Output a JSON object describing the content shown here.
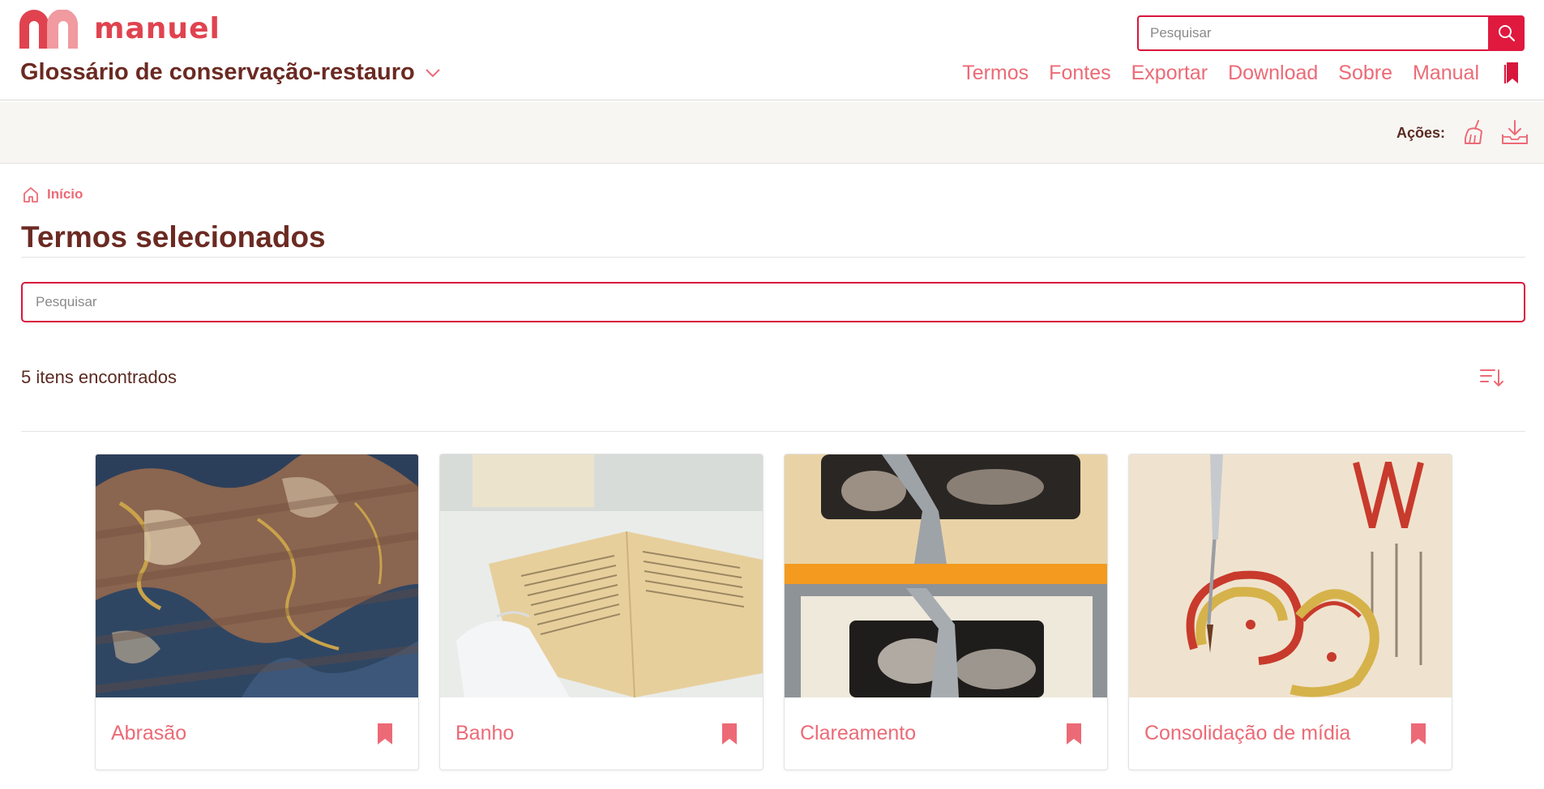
{
  "brand": {
    "logo_text": "manuel",
    "site_title": "Glossário de conservação-restauro"
  },
  "header_search": {
    "placeholder": "Pesquisar"
  },
  "nav": {
    "items": [
      {
        "label": "Termos"
      },
      {
        "label": "Fontes"
      },
      {
        "label": "Exportar"
      },
      {
        "label": "Download"
      },
      {
        "label": "Sobre"
      },
      {
        "label": "Manual"
      }
    ]
  },
  "actions": {
    "label": "Ações:",
    "icons": [
      "broom-icon",
      "download-icon"
    ]
  },
  "breadcrumb": {
    "home_label": "Início"
  },
  "page": {
    "title": "Termos selecionados"
  },
  "search": {
    "placeholder": "Pesquisar"
  },
  "results": {
    "count_text": "5 itens encontrados"
  },
  "cards": [
    {
      "title": "Abrasão",
      "image": "marbled-paper-abrasion"
    },
    {
      "title": "Banho",
      "image": "paper-bath"
    },
    {
      "title": "Clareamento",
      "image": "engraving-bleaching"
    },
    {
      "title": "Consolidação de mídia",
      "image": "illuminated-manuscript-brush"
    }
  ],
  "colors": {
    "accent": "#e0193f",
    "link": "#ec6a76",
    "text_dark": "#6b2a22",
    "bar_bg": "#f7f6f3"
  }
}
